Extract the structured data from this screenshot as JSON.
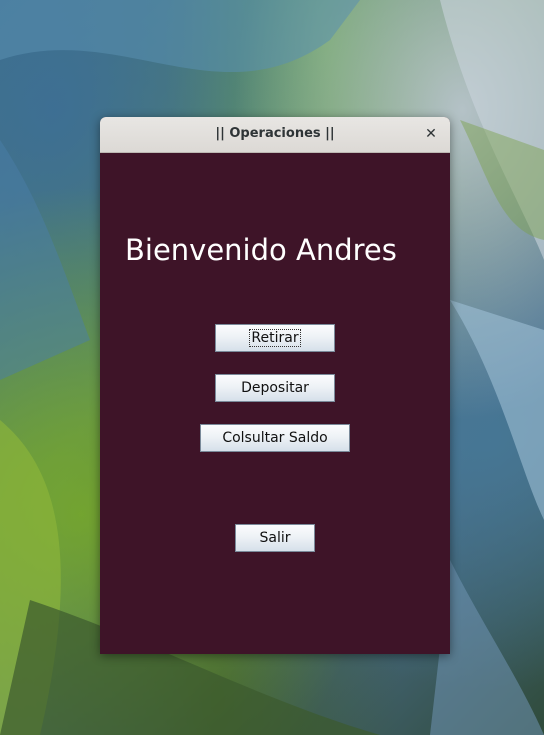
{
  "window": {
    "title": "|| Operaciones ||",
    "close_icon": "close-icon",
    "background_color": "#3e1428"
  },
  "main": {
    "welcome_text": "Bienvenido Andres",
    "buttons": {
      "retirar": "Retirar",
      "depositar": "Depositar",
      "consultar_saldo": "Colsultar Saldo",
      "salir": "Salir"
    }
  },
  "glyphs": {
    "close": "✕"
  }
}
